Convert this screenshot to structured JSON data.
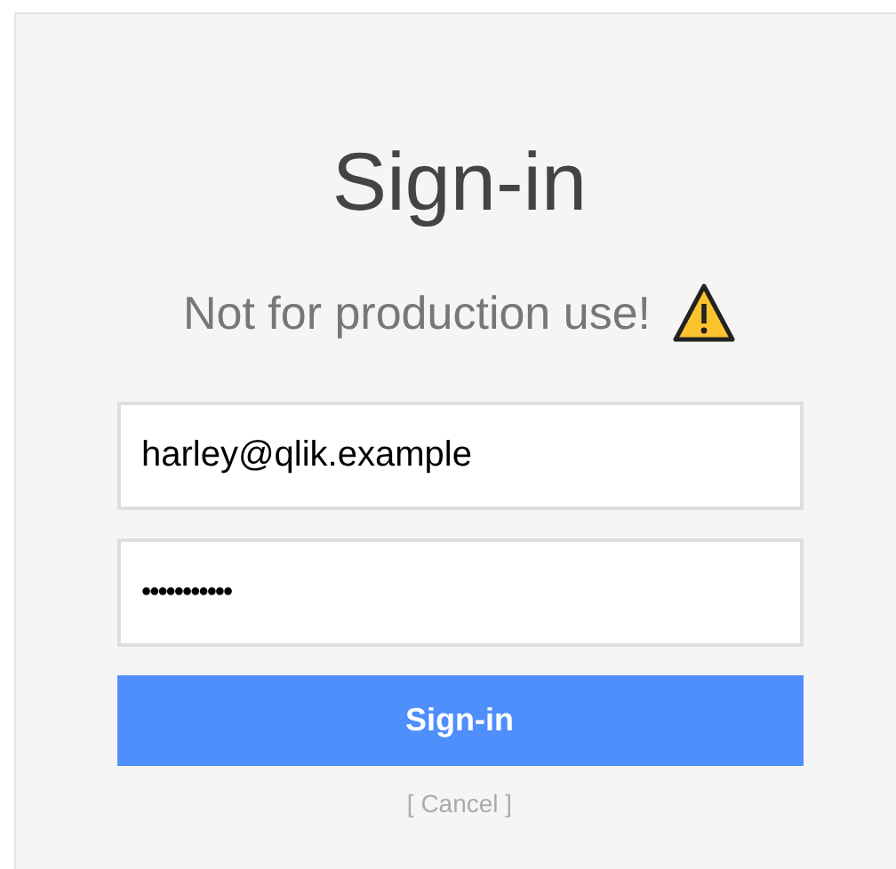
{
  "title": "Sign-in",
  "warning": {
    "text": "Not for production use!"
  },
  "fields": [
    {
      "kind": "text",
      "value": "harley@qlik.example"
    },
    {
      "kind": "password",
      "value": "•••••••••••"
    }
  ],
  "submit_button": "Sign-in",
  "cancel_link": "[ Cancel ]"
}
